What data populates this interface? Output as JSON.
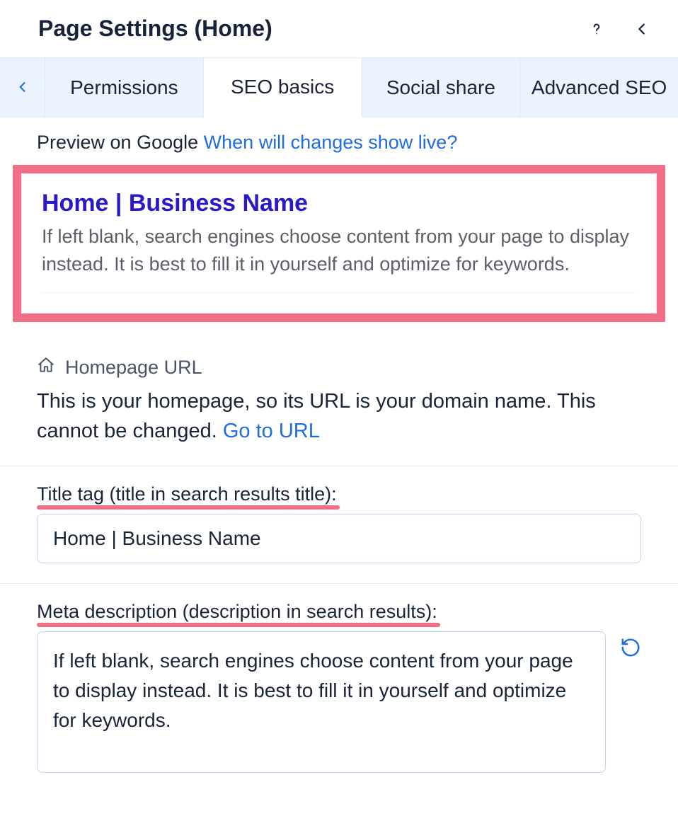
{
  "header": {
    "title": "Page Settings (Home)"
  },
  "tabs": {
    "items": [
      "Permissions",
      "SEO basics",
      "Social share",
      "Advanced SEO"
    ],
    "active_index": 1
  },
  "preview": {
    "label": "Preview on Google",
    "link_text": "When will changes show live?",
    "title": "Home | Business Name",
    "description": "If left blank, search engines choose content from your page to display instead. It is best to fill it in yourself and optimize for keywords."
  },
  "homepage_url": {
    "label": "Homepage URL",
    "description_prefix": "This is your homepage, so its URL is your domain name. This cannot be changed. ",
    "link_text": "Go to URL"
  },
  "title_tag": {
    "label": "Title tag (title in search results title):",
    "value": "Home | Business Name"
  },
  "meta_description": {
    "label": "Meta description (description in search results):",
    "value": "If left blank, search engines choose content from your page to display instead. It is best to fill it in yourself and optimize for keywords."
  }
}
